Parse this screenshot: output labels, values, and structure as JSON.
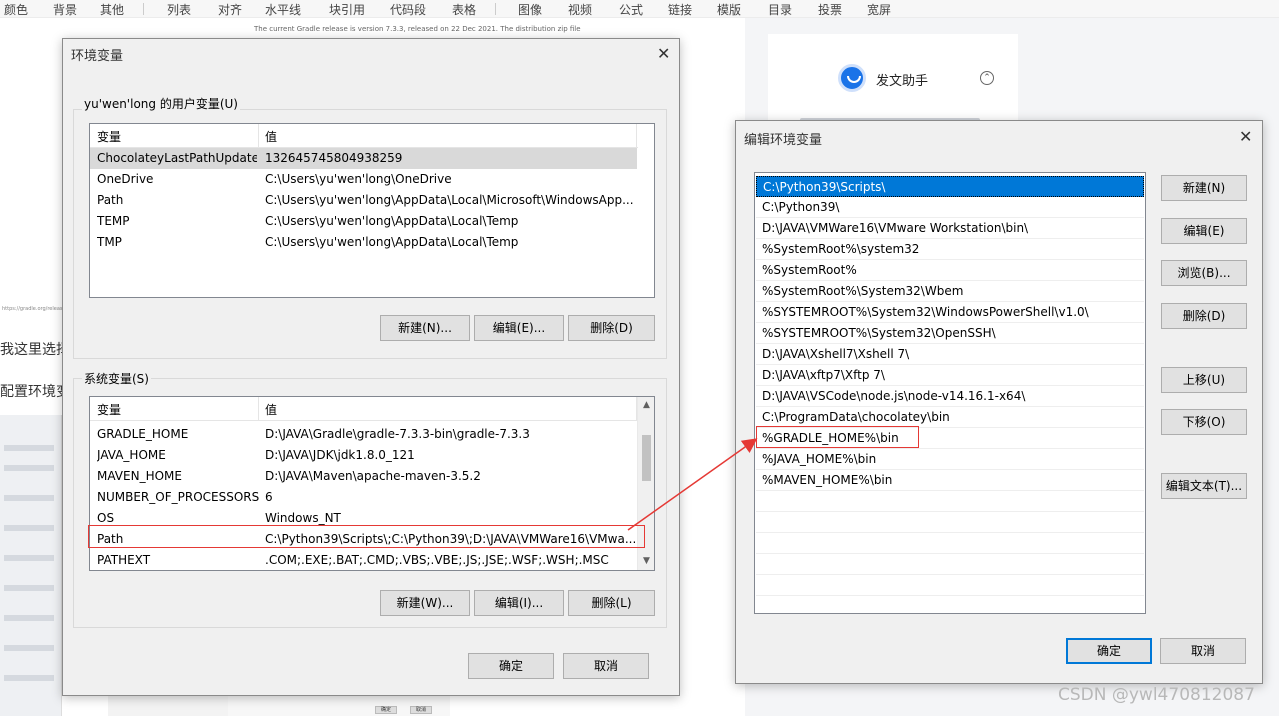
{
  "toolbar": {
    "items": [
      "颜色",
      "背景",
      "其他",
      "列表",
      "对齐",
      "水平线",
      "块引用",
      "代码段",
      "表格",
      "图像",
      "视频",
      "公式",
      "链接",
      "模版",
      "目录",
      "投票",
      "宽屏"
    ]
  },
  "article": {
    "release_line": "The current Gradle release is version 7.3.3, released on 22 Dec 2021. The distribution zip file",
    "url": "https://gradle.org/releases/",
    "text1": "我这里选择",
    "text2": "配置环境变"
  },
  "assistant": {
    "title": "发文助手",
    "toggle": "⌃"
  },
  "env_dialog": {
    "title": "环境变量",
    "user_group_label": "yu'wen'long 的用户变量(U)",
    "col_var": "变量",
    "col_val": "值",
    "user_vars": [
      {
        "name": "ChocolateyLastPathUpdate",
        "value": "132645745804938259"
      },
      {
        "name": "OneDrive",
        "value": "C:\\Users\\yu'wen'long\\OneDrive"
      },
      {
        "name": "Path",
        "value": "C:\\Users\\yu'wen'long\\AppData\\Local\\Microsoft\\WindowsApp..."
      },
      {
        "name": "TEMP",
        "value": "C:\\Users\\yu'wen'long\\AppData\\Local\\Temp"
      },
      {
        "name": "TMP",
        "value": "C:\\Users\\yu'wen'long\\AppData\\Local\\Temp"
      }
    ],
    "user_new": "新建(N)...",
    "user_edit": "编辑(E)...",
    "user_delete": "删除(D)",
    "sys_group_label": "系统变量(S)",
    "sys_vars": [
      {
        "name": "GRADLE_HOME",
        "value": "D:\\JAVA\\Gradle\\gradle-7.3.3-bin\\gradle-7.3.3"
      },
      {
        "name": "JAVA_HOME",
        "value": "D:\\JAVA\\JDK\\jdk1.8.0_121"
      },
      {
        "name": "MAVEN_HOME",
        "value": "D:\\JAVA\\Maven\\apache-maven-3.5.2"
      },
      {
        "name": "NUMBER_OF_PROCESSORS",
        "value": "6"
      },
      {
        "name": "OS",
        "value": "Windows_NT"
      },
      {
        "name": "Path",
        "value": "C:\\Python39\\Scripts\\;C:\\Python39\\;D:\\JAVA\\VMWare16\\VMwa..."
      },
      {
        "name": "PATHEXT",
        "value": ".COM;.EXE;.BAT;.CMD;.VBS;.VBE;.JS;.JSE;.WSF;.WSH;.MSC"
      }
    ],
    "sys_new": "新建(W)...",
    "sys_edit": "编辑(I)...",
    "sys_delete": "删除(L)",
    "ok": "确定",
    "cancel": "取消"
  },
  "edit_dialog": {
    "title": "编辑环境变量",
    "entries": [
      "C:\\Python39\\Scripts\\",
      "C:\\Python39\\",
      "D:\\JAVA\\VMWare16\\VMware Workstation\\bin\\",
      "%SystemRoot%\\system32",
      "%SystemRoot%",
      "%SystemRoot%\\System32\\Wbem",
      "%SYSTEMROOT%\\System32\\WindowsPowerShell\\v1.0\\",
      "%SYSTEMROOT%\\System32\\OpenSSH\\",
      "D:\\JAVA\\Xshell7\\Xshell 7\\",
      "D:\\JAVA\\xftp7\\Xftp 7\\",
      "D:\\JAVA\\VSCode\\node.js\\node-v14.16.1-x64\\",
      "C:\\ProgramData\\chocolatey\\bin",
      "%GRADLE_HOME%\\bin",
      "%JAVA_HOME%\\bin",
      "%MAVEN_HOME%\\bin"
    ],
    "new": "新建(N)",
    "edit": "编辑(E)",
    "browse": "浏览(B)...",
    "delete": "删除(D)",
    "move_up": "上移(U)",
    "move_down": "下移(O)",
    "edit_text": "编辑文本(T)...",
    "ok": "确定",
    "cancel": "取消"
  },
  "thumb_buttons": [
    "确定",
    "取消"
  ],
  "watermark": "CSDN @ywl470812087",
  "colors": {
    "highlight": "#e53935",
    "selection": "#0078d7"
  }
}
